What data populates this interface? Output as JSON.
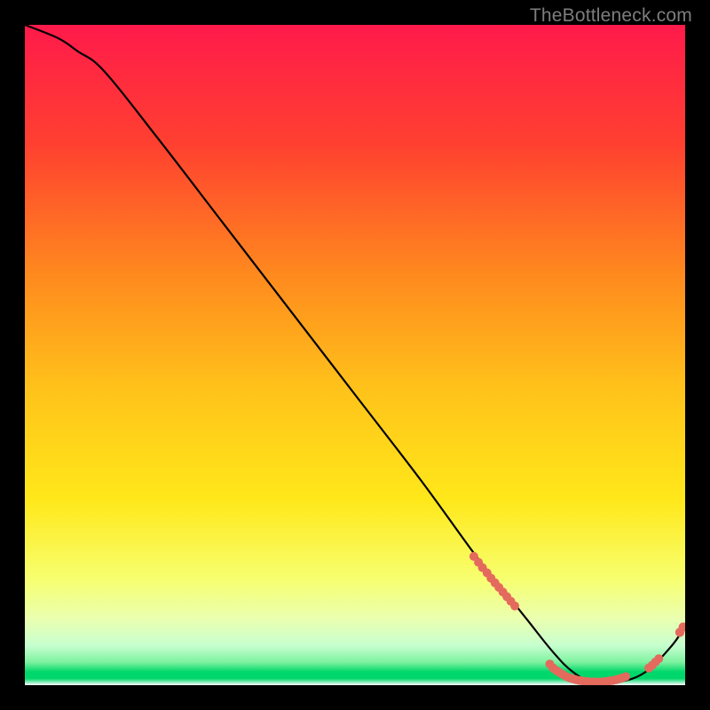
{
  "watermark": "TheBottleneck.com",
  "colors": {
    "top": "#ff1a4b",
    "upper": "#ff5a2e",
    "mid": "#ffb01a",
    "low": "#ffe21a",
    "pale": "#f7ff8e",
    "cream": "#f3ffd0",
    "mint": "#85f0a3",
    "green": "#00d76a",
    "bottom_bg": "#ffffff",
    "dot": "#e46a5e",
    "curve": "#000000"
  },
  "chart_data": {
    "type": "line",
    "title": "",
    "xlabel": "",
    "ylabel": "",
    "xlim": [
      0,
      100
    ],
    "ylim": [
      0,
      100
    ],
    "series": [
      {
        "name": "bottleneck-curve",
        "x": [
          0,
          5,
          8,
          12,
          20,
          30,
          40,
          50,
          60,
          68,
          72,
          76,
          80,
          83,
          86,
          90,
          94,
          98,
          100
        ],
        "y": [
          100,
          98,
          96,
          93,
          83,
          70,
          57,
          44,
          31,
          20,
          15,
          10,
          5,
          2,
          0.5,
          0.5,
          2,
          6,
          9
        ]
      }
    ],
    "dot_clusters": [
      {
        "name": "upper-slope-cluster",
        "points": [
          [
            68,
            19.5
          ],
          [
            68.7,
            18.6
          ],
          [
            69.3,
            17.8
          ],
          [
            70,
            17
          ],
          [
            70.6,
            16.2
          ],
          [
            71.2,
            15.5
          ],
          [
            71.8,
            14.8
          ],
          [
            72.4,
            14.1
          ],
          [
            73.0,
            13.4
          ],
          [
            73.6,
            12.7
          ],
          [
            74.2,
            12.0
          ]
        ]
      },
      {
        "name": "valley-cluster",
        "points": [
          [
            79.5,
            3.2
          ],
          [
            80,
            2.6
          ],
          [
            80.5,
            2.2
          ],
          [
            81,
            1.9
          ],
          [
            81.5,
            1.6
          ],
          [
            82,
            1.3
          ],
          [
            82.5,
            1.1
          ],
          [
            83,
            0.95
          ],
          [
            83.5,
            0.8
          ],
          [
            84,
            0.7
          ],
          [
            84.5,
            0.62
          ],
          [
            85,
            0.55
          ],
          [
            85.5,
            0.5
          ],
          [
            86,
            0.48
          ],
          [
            86.5,
            0.47
          ],
          [
            87,
            0.47
          ],
          [
            87.5,
            0.5
          ],
          [
            88,
            0.55
          ],
          [
            88.5,
            0.62
          ],
          [
            89,
            0.7
          ],
          [
            89.5,
            0.8
          ],
          [
            90,
            0.95
          ],
          [
            90.5,
            1.1
          ],
          [
            91,
            1.3
          ]
        ]
      },
      {
        "name": "rise-cluster",
        "points": [
          [
            94.5,
            2.6
          ],
          [
            95,
            3.0
          ],
          [
            95.5,
            3.5
          ],
          [
            96,
            4.0
          ]
        ]
      },
      {
        "name": "tail-pair",
        "points": [
          [
            99.2,
            8.0
          ],
          [
            99.7,
            8.8
          ]
        ]
      }
    ]
  }
}
